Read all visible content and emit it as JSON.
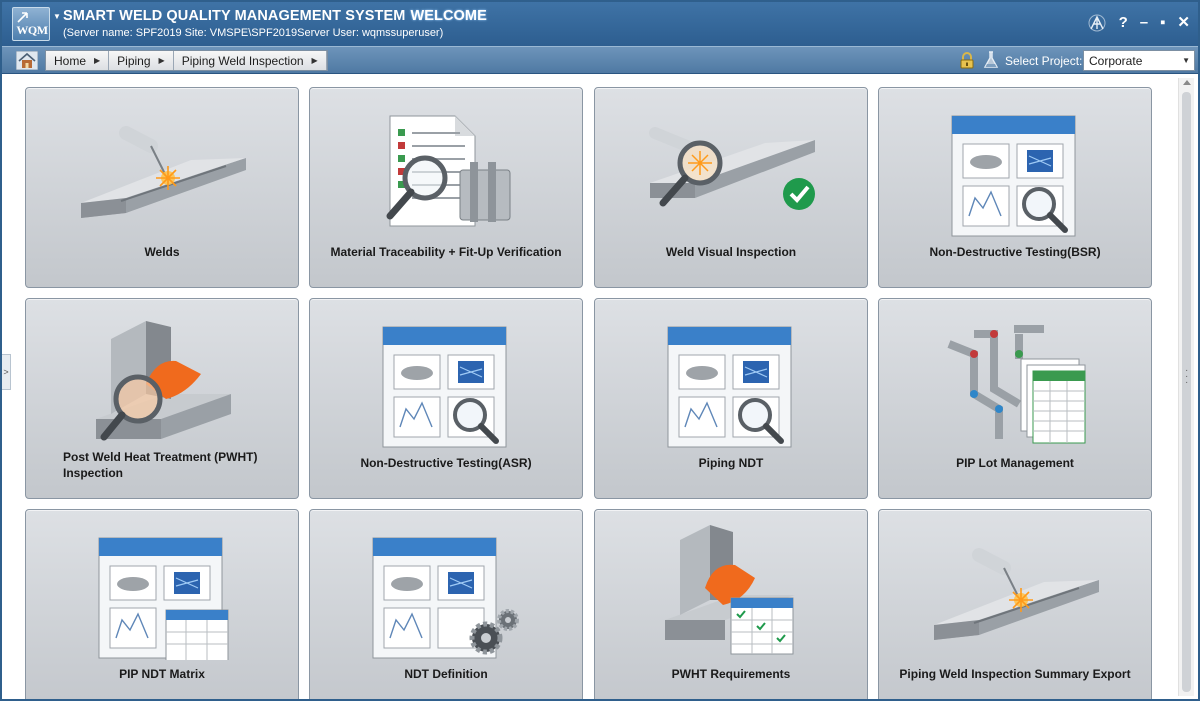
{
  "window": {
    "title": "SMART WELD QUALITY MANAGEMENT SYSTEM",
    "welcome": "WELCOME",
    "server_info": "(Server name: SPF2019 Site: VMSPE\\SPF2019Server User: wqmssuperuser)",
    "logo_text": "WQM",
    "controls": {
      "help": "?",
      "minimize": "–",
      "maximize": "▪",
      "close": "✕"
    }
  },
  "nav": {
    "breadcrumbs": [
      "Home",
      "Piping",
      "Piping Weld Inspection"
    ],
    "select_project_label": "Select Project:",
    "project_value": "Corporate"
  },
  "tiles": [
    {
      "label": "Welds",
      "icon": "welding-torch-icon"
    },
    {
      "label": "Material Traceability + Fit-Up Verification",
      "icon": "document-magnifier-icon"
    },
    {
      "label": "Weld Visual Inspection",
      "icon": "weld-inspect-check-icon"
    },
    {
      "label": "Non-Destructive Testing(BSR)",
      "icon": "ndt-panel-icon"
    },
    {
      "label": "Post Weld Heat Treatment (PWHT) Inspection",
      "icon": "pwht-inspection-icon"
    },
    {
      "label": "Non-Destructive Testing(ASR)",
      "icon": "ndt-panel-icon"
    },
    {
      "label": "Piping NDT",
      "icon": "ndt-panel-icon"
    },
    {
      "label": "PIP Lot Management",
      "icon": "pipe-spreadsheet-icon"
    },
    {
      "label": "PIP NDT Matrix",
      "icon": "ndt-matrix-icon"
    },
    {
      "label": "NDT Definition",
      "icon": "ndt-gears-icon"
    },
    {
      "label": "PWHT Requirements",
      "icon": "pwht-grid-icon"
    },
    {
      "label": "Piping Weld Inspection Summary Export",
      "icon": "welding-torch-icon"
    }
  ],
  "matrix_symbol": "%",
  "colors": {
    "titlebar": "#3f73a6",
    "tile_bg": "#c9cdd2",
    "accent_orange": "#f06a1d",
    "check_green": "#1f9a4c",
    "panel_header": "#3a80c9"
  }
}
